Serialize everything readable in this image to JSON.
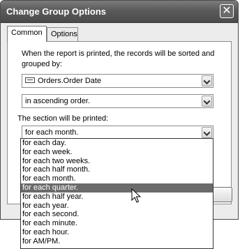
{
  "window": {
    "title": "Change Group Options",
    "close_label": "✕"
  },
  "tabs": [
    {
      "label": "Common",
      "active": true
    },
    {
      "label": "Options",
      "active": false
    }
  ],
  "common": {
    "description": "When the report is printed, the records will be sorted and grouped by:",
    "group_by_field": "Orders.Order Date",
    "sort_order": "in ascending order.",
    "section_label": "The section will be printed:",
    "section_value": "for each month."
  },
  "dropdown": {
    "options": [
      "for each day.",
      "for each week.",
      "for each two weeks.",
      "for each half month.",
      "for each month.",
      "for each quarter.",
      "for each half year.",
      "for each year.",
      "for each second.",
      "for each minute.",
      "for each hour.",
      "for AM/PM."
    ],
    "highlighted": "for each quarter."
  },
  "icons": {
    "close": "close-icon",
    "field": "database-field-icon",
    "dropdown_arrow": "chevron-down-icon",
    "cursor": "mouse-pointer-icon"
  },
  "colors": {
    "titlebar": "#5a5a5a",
    "selection": "#6b6b6b"
  }
}
